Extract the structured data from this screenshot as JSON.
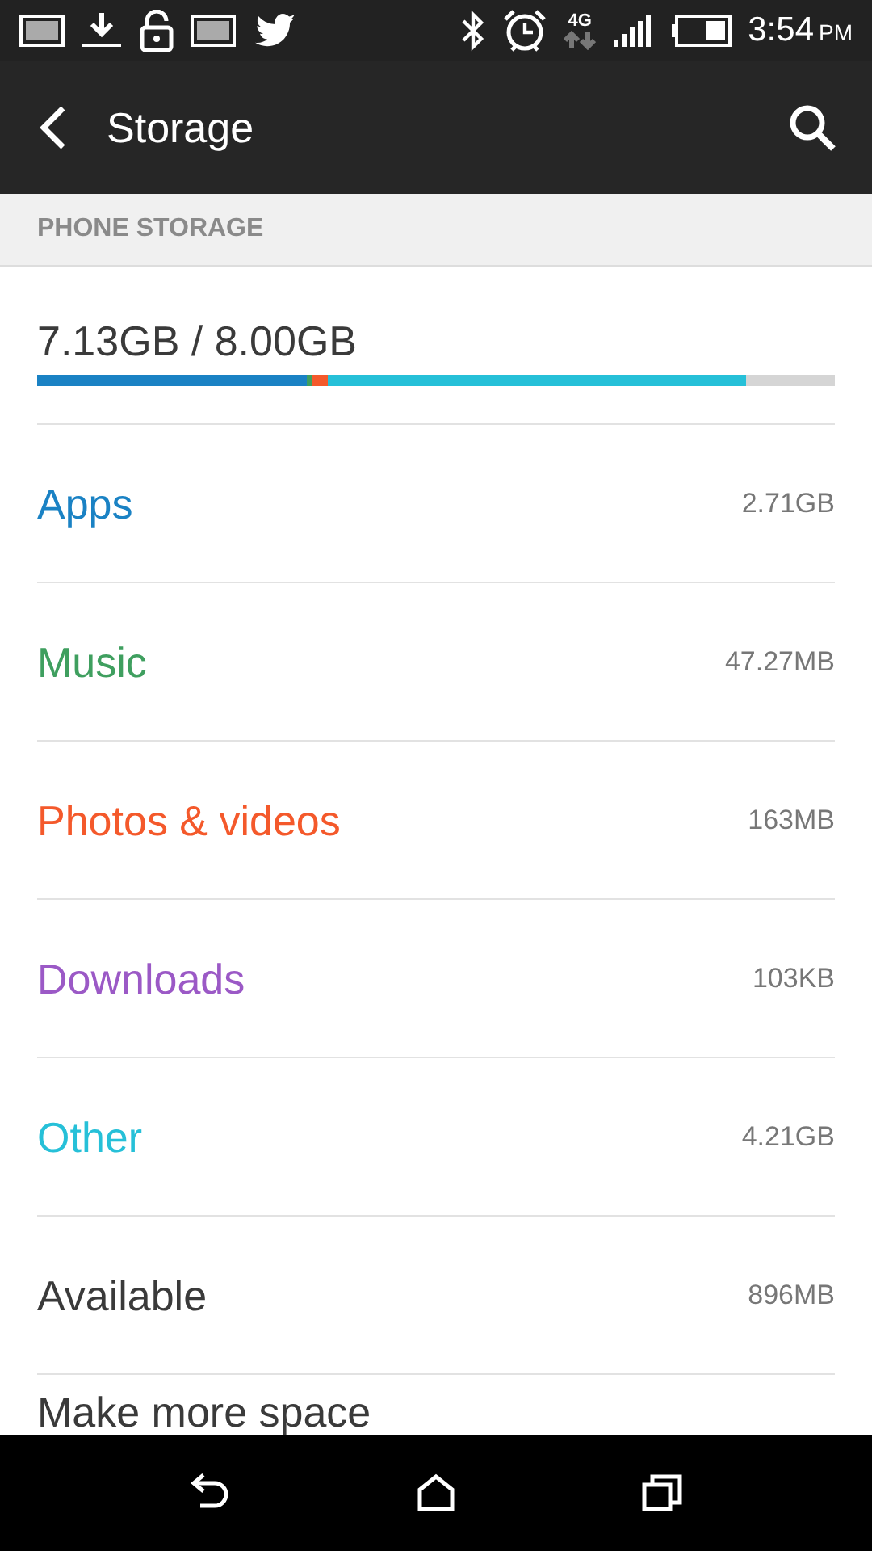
{
  "status_bar": {
    "time": "3:54",
    "ampm": "PM",
    "network": "4G"
  },
  "app_bar": {
    "title": "Storage"
  },
  "section": {
    "title": "PHONE STORAGE"
  },
  "total": {
    "text": "7.13GB / 8.00GB"
  },
  "rows": [
    {
      "kind": "used",
      "label": "Apps",
      "value": "2.71GB",
      "color": "#1a82c4"
    },
    {
      "kind": "used",
      "label": "Music",
      "value": "47.27MB",
      "color": "#3f9f5f"
    },
    {
      "kind": "used",
      "label": "Photos & videos",
      "value": "163MB",
      "color": "#f4592b"
    },
    {
      "kind": "used",
      "label": "Downloads",
      "value": "103KB",
      "color": "#9b59c6"
    },
    {
      "kind": "used",
      "label": "Other",
      "value": "4.21GB",
      "color": "#26c0d8"
    },
    {
      "kind": "free",
      "label": "Available",
      "value": "896MB",
      "color": "#3a3a3a"
    },
    {
      "kind": "action",
      "label": "Make more space",
      "color": "#3a3a3a"
    }
  ]
}
